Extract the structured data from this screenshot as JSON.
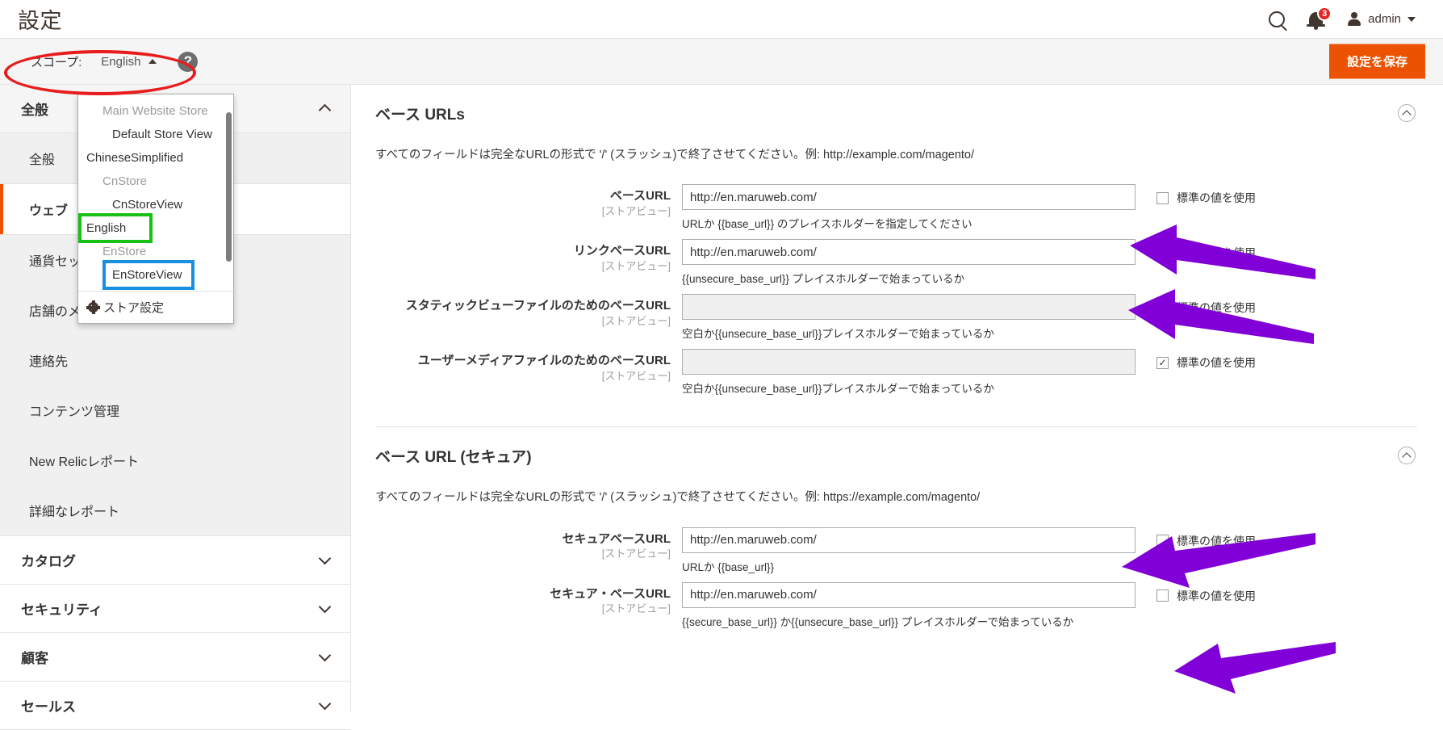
{
  "header": {
    "title": "設定",
    "search_icon": "search-icon",
    "notifications_icon": "bell-icon",
    "notifications_count": "3",
    "user_name": "admin",
    "user_caret": "chevron-down-icon"
  },
  "scope_bar": {
    "label": "スコープ:",
    "value": "English",
    "help_icon": "question-mark-icon",
    "save_label": "設定を保存"
  },
  "scope_dropdown": {
    "items": [
      {
        "label": "Main Website Store",
        "level": "store-muted"
      },
      {
        "label": "Default Store View",
        "level": "view"
      },
      {
        "label": "ChineseSimplified",
        "level": "website"
      },
      {
        "label": "CnStore",
        "level": "store-muted"
      },
      {
        "label": "CnStoreView",
        "level": "view"
      },
      {
        "label": "English",
        "level": "website",
        "highlight": "green"
      },
      {
        "label": "EnStore",
        "level": "store-muted"
      },
      {
        "label": "EnStoreView",
        "level": "view",
        "highlight": "blue"
      }
    ],
    "footer_label": "ストア設定",
    "footer_icon": "gear-icon"
  },
  "sidebar": {
    "sections": [
      {
        "title": "全般",
        "expanded": true,
        "chevron": "chevron-up-icon",
        "items": [
          {
            "label": "全般",
            "active": false
          },
          {
            "label": "ウェブ",
            "active": true
          },
          {
            "label": "通貨セットアップ",
            "active": false
          },
          {
            "label": "店舗のメールアドレス",
            "active": false
          },
          {
            "label": "連絡先",
            "active": false
          },
          {
            "label": "コンテンツ管理",
            "active": false
          },
          {
            "label": "New Relicレポート",
            "active": false
          },
          {
            "label": "詳細なレポート",
            "active": false
          }
        ]
      },
      {
        "title": "カタログ",
        "expanded": false,
        "chevron": "chevron-down-icon",
        "items": []
      },
      {
        "title": "セキュリティ",
        "expanded": false,
        "chevron": "chevron-down-icon",
        "items": []
      },
      {
        "title": "顧客",
        "expanded": false,
        "chevron": "chevron-down-icon",
        "items": []
      },
      {
        "title": "セールス",
        "expanded": false,
        "chevron": "chevron-down-icon",
        "items": []
      }
    ]
  },
  "main": {
    "fieldsets": [
      {
        "title": "ベース URLs",
        "collapse_icon": "chevron-up-circle-icon",
        "note": "すべてのフィールドは完全なURLの形式で '/' (スラッシュ)で終了させてください。例: http://example.com/magento/",
        "fields": [
          {
            "label": "ベースURL",
            "scope": "[ストアビュー]",
            "value": "http://en.maruweb.com/",
            "hint": "URLか {{base_url}} のプレイスホルダーを指定してください",
            "disabled": false,
            "inherit_checked": false,
            "inherit_label": "標準の値を使用"
          },
          {
            "label": "リンクベースURL",
            "scope": "[ストアビュー]",
            "value": "http://en.maruweb.com/",
            "hint": "{{unsecure_base_url}} プレイスホルダーで始まっているか",
            "disabled": false,
            "inherit_checked": false,
            "inherit_label": "標準の値を使用"
          },
          {
            "label": "スタティックビューファイルのためのベースURL",
            "scope": "[ストアビュー]",
            "value": "",
            "hint": "空白か{{unsecure_base_url}}プレイスホルダーで始まっているか",
            "disabled": true,
            "inherit_checked": true,
            "inherit_label": "標準の値を使用"
          },
          {
            "label": "ユーザーメディアファイルのためのベースURL",
            "scope": "[ストアビュー]",
            "value": "",
            "hint": "空白か{{unsecure_base_url}}プレイスホルダーで始まっているか",
            "disabled": true,
            "inherit_checked": true,
            "inherit_label": "標準の値を使用"
          }
        ]
      },
      {
        "title": "ベース URL (セキュア)",
        "collapse_icon": "chevron-up-circle-icon",
        "note": "すべてのフィールドは完全なURLの形式で '/' (スラッシュ)で終了させてください。例: https://example.com/magento/",
        "fields": [
          {
            "label": "セキュアベースURL",
            "scope": "[ストアビュー]",
            "value": "http://en.maruweb.com/",
            "hint": "URLか {{base_url}}",
            "disabled": false,
            "inherit_checked": false,
            "inherit_label": "標準の値を使用"
          },
          {
            "label": "セキュア・ベースURL",
            "scope": "[ストアビュー]",
            "value": "http://en.maruweb.com/",
            "hint": "{{secure_base_url}} か{{unsecure_base_url}} プレイスホルダーで始まっているか",
            "disabled": false,
            "inherit_checked": false,
            "inherit_label": "標準の値を使用"
          }
        ]
      }
    ]
  },
  "annotations": {
    "ellipse_color": "#e81c1c",
    "green_box_color": "#18c018",
    "blue_box_color": "#1a8fe0",
    "arrow_color": "#8000d7"
  }
}
